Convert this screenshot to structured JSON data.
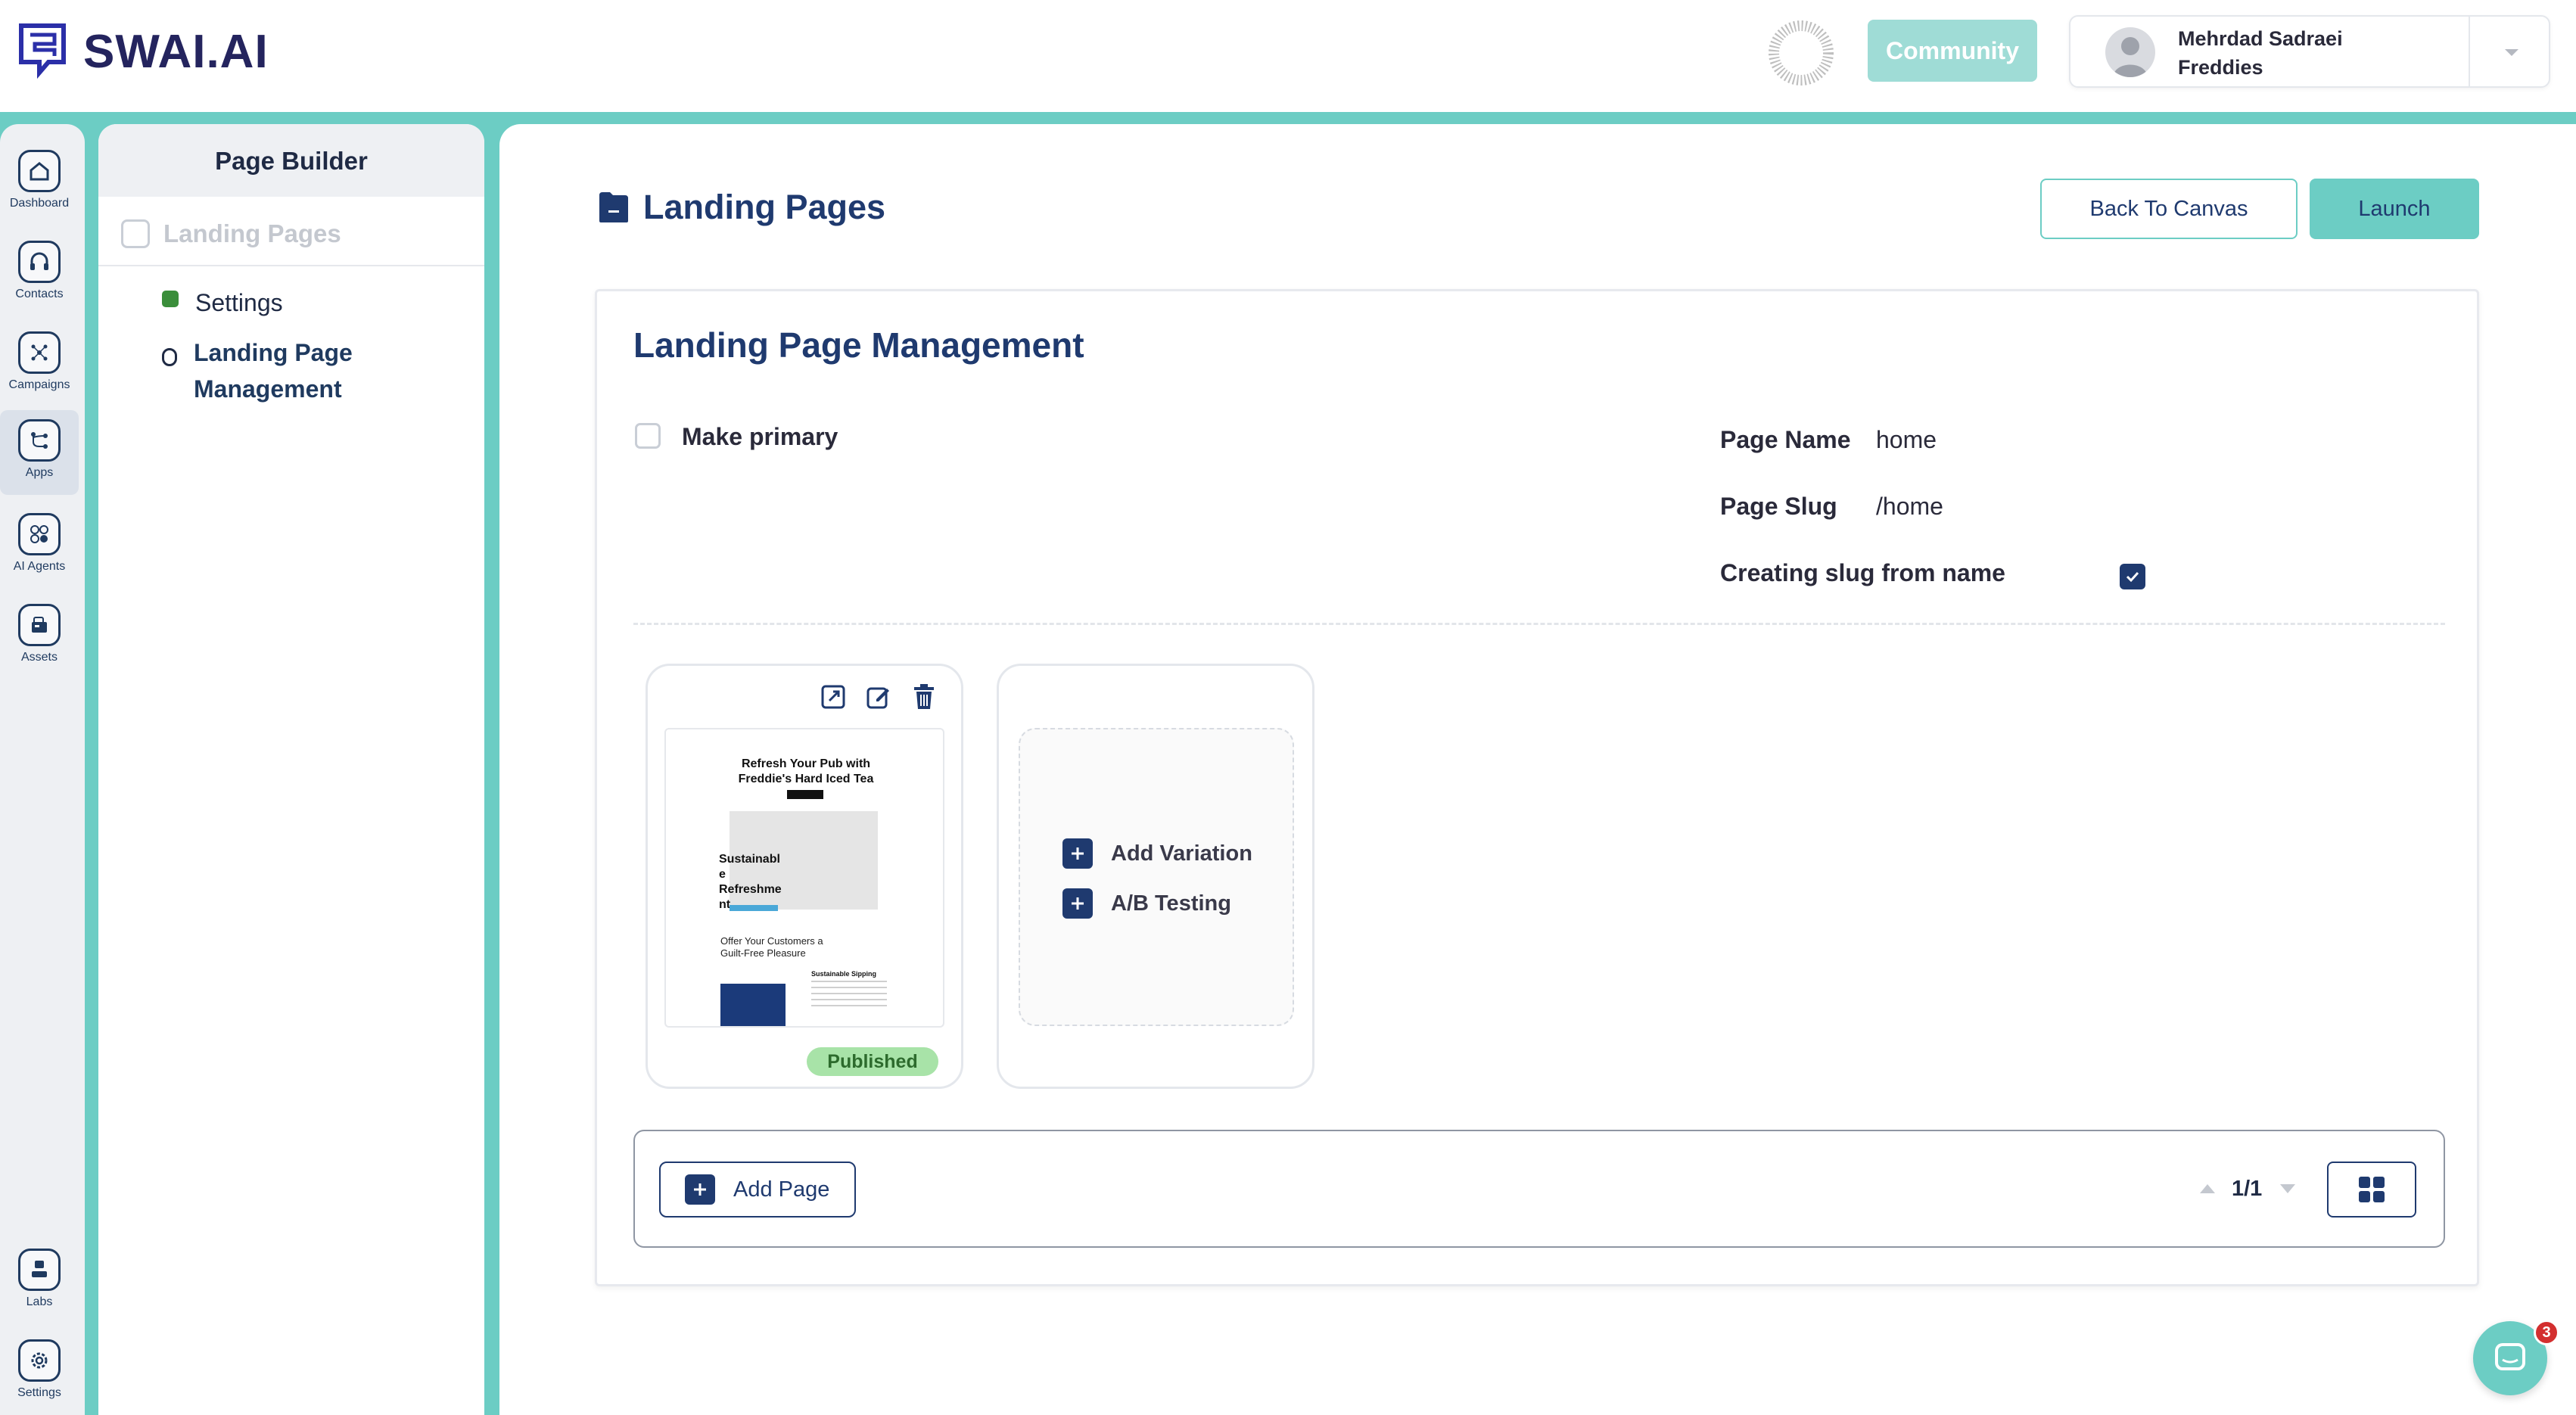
{
  "header": {
    "logo_text": "SWAI.AI",
    "community_label": "Community",
    "user": {
      "name": "Mehrdad Sadraei",
      "org": "Freddies"
    }
  },
  "rail": {
    "items": [
      {
        "label": "Dashboard",
        "icon": "home-icon"
      },
      {
        "label": "Contacts",
        "icon": "headset-icon"
      },
      {
        "label": "Campaigns",
        "icon": "network-icon"
      },
      {
        "label": "Apps",
        "icon": "flow-icon",
        "active": true
      },
      {
        "label": "AI Agents",
        "icon": "agents-icon"
      },
      {
        "label": "Assets",
        "icon": "assets-icon"
      },
      {
        "label": "Labs",
        "icon": "labs-icon"
      },
      {
        "label": "Settings",
        "icon": "gear-icon"
      }
    ]
  },
  "sidebar": {
    "title": "Page Builder",
    "section_label": "Landing Pages",
    "items": [
      {
        "label": "Settings",
        "status": "complete"
      },
      {
        "label": "Landing Page Management",
        "status": "current"
      }
    ]
  },
  "main": {
    "title": "Landing Pages",
    "back_label": "Back To Canvas",
    "launch_label": "Launch",
    "card": {
      "title": "Landing Page Management",
      "make_primary_label": "Make primary",
      "make_primary_checked": false,
      "page_name_label": "Page Name",
      "page_name_value": "home",
      "page_slug_label": "Page Slug",
      "page_slug_value": "/home",
      "slug_from_name_label": "Creating slug from name",
      "slug_from_name_checked": true
    },
    "page_tile": {
      "status": "Published",
      "preview": {
        "headline": "Refresh Your Pub with Freddie's Hard Iced Tea",
        "hero_text": "Sustainabl e Refreshme nt",
        "offer_text": "Offer Your Customers a Guilt-Free Pleasure",
        "section_title": "Sustainable Sipping"
      }
    },
    "variation_tile": {
      "add_variation_label": "Add Variation",
      "ab_testing_label": "A/B Testing"
    },
    "footer": {
      "add_page_label": "Add Page",
      "pagination": "1/1"
    }
  },
  "chat": {
    "unread_count": "3"
  },
  "colors": {
    "accent": "#6ccdc4",
    "brand_navy": "#1f3a6f",
    "community_bg": "#9fdcd6",
    "published_bg": "#a8e3a8"
  }
}
